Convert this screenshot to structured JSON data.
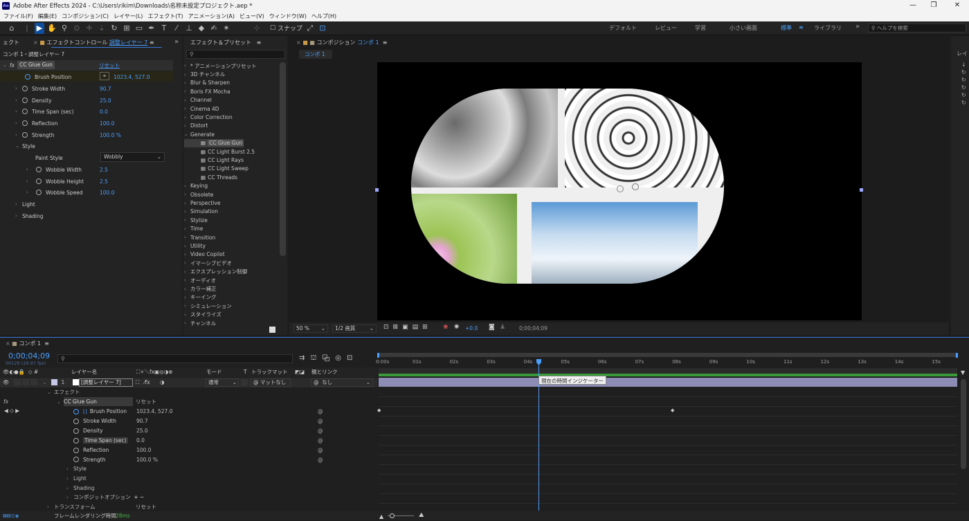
{
  "app": {
    "title": "Adobe After Effects 2024 - C:\\Users\\rikim\\Downloads\\名称未設定プロジェクト.aep *",
    "logo": "Ae"
  },
  "menu": [
    "ファイル(F)",
    "編集(E)",
    "コンポジション(C)",
    "レイヤー(L)",
    "エフェクト(T)",
    "アニメーション(A)",
    "ビュー(V)",
    "ウィンドウ(W)",
    "ヘルプ(H)"
  ],
  "toolbar": {
    "snap": "スナップ",
    "workspaces": [
      "デフォルト",
      "レビュー",
      "学習",
      "小さい画面",
      "標準",
      "ライブラリ"
    ],
    "active_workspace": "標準",
    "help_placeholder": "ヘルプを検索"
  },
  "effect_controls": {
    "left_tab": "ェクト",
    "tab_label": "エフェクトコントロール",
    "tab_layer": "調整レイヤー 7",
    "breadcrumb": "コンポ 1・調整レイヤー 7",
    "effect_name": "CC Glue Gun",
    "reset": "リセット",
    "props": [
      {
        "name": "Brush Position",
        "value": "1023.4, 527.0",
        "stop": true,
        "active": true
      },
      {
        "name": "Stroke Width",
        "value": "90.7"
      },
      {
        "name": "Density",
        "value": "25.0"
      },
      {
        "name": "Time Span (sec)",
        "value": "0.0"
      },
      {
        "name": "Reflection",
        "value": "100.0"
      },
      {
        "name": "Strength",
        "value": "100.0 %"
      }
    ],
    "style_group": "Style",
    "paint_style_label": "Paint Style",
    "paint_style_value": "Wobbly",
    "wobble": [
      {
        "name": "Wobble Width",
        "value": "2.5"
      },
      {
        "name": "Wobble Height",
        "value": "2.5"
      },
      {
        "name": "Wobble Speed",
        "value": "100.0"
      }
    ],
    "light": "Light",
    "shading": "Shading"
  },
  "effects_presets": {
    "tab": "エフェクト＆プリセット",
    "search_placeholder": "",
    "items": [
      {
        "label": "* アニメーションプリセット",
        "indent": 0
      },
      {
        "label": "3D チャンネル",
        "indent": 0
      },
      {
        "label": "Blur & Sharpen",
        "indent": 0
      },
      {
        "label": "Boris FX Mocha",
        "indent": 0
      },
      {
        "label": "Channel",
        "indent": 0
      },
      {
        "label": "Cinema 4D",
        "indent": 0
      },
      {
        "label": "Color Correction",
        "indent": 0
      },
      {
        "label": "Distort",
        "indent": 0
      },
      {
        "label": "Generate",
        "indent": 0,
        "open": true
      },
      {
        "label": "CC Glue Gun",
        "indent": 1,
        "selected": true
      },
      {
        "label": "CC Light Burst 2.5",
        "indent": 1
      },
      {
        "label": "CC Light Rays",
        "indent": 1
      },
      {
        "label": "CC Light Sweep",
        "indent": 1
      },
      {
        "label": "CC Threads",
        "indent": 1
      },
      {
        "label": "Keying",
        "indent": 0
      },
      {
        "label": "Obsolete",
        "indent": 0
      },
      {
        "label": "Perspective",
        "indent": 0
      },
      {
        "label": "Simulation",
        "indent": 0
      },
      {
        "label": "Stylize",
        "indent": 0
      },
      {
        "label": "Time",
        "indent": 0
      },
      {
        "label": "Transition",
        "indent": 0
      },
      {
        "label": "Utility",
        "indent": 0
      },
      {
        "label": "Video Copilot",
        "indent": 0
      },
      {
        "label": "イマーシブビデオ",
        "indent": 0
      },
      {
        "label": "エクスプレッション制御",
        "indent": 0
      },
      {
        "label": "オーディオ",
        "indent": 0
      },
      {
        "label": "カラー補正",
        "indent": 0
      },
      {
        "label": "キーイング",
        "indent": 0
      },
      {
        "label": "シミュレーション",
        "indent": 0
      },
      {
        "label": "スタイライズ",
        "indent": 0
      },
      {
        "label": "チャンネル",
        "indent": 0
      }
    ]
  },
  "composition": {
    "tab_label": "コンポジション",
    "comp_name": "コンポ 1",
    "subtab": "コンポ 1",
    "zoom": "50 %",
    "resolution": "1/2 画質",
    "exposure": "+0.0",
    "timecode": "0;00;04;09"
  },
  "timeline": {
    "tab": "コンポ 1",
    "timecode": "0;00;04;09",
    "frame_info": "00129 (29.97 fps)",
    "search_placeholder": "",
    "headers": {
      "layer_name": "レイヤー名",
      "mode": "モード",
      "t": "T",
      "track_matte": "トラックマット",
      "parent": "親とリンク",
      "num": "#"
    },
    "layer": {
      "num": "1",
      "name": "[調整レイヤー 7]",
      "mode": "通常",
      "matte": "マットなし",
      "parent": "なし"
    },
    "effects_group": "エフェクト",
    "effect_name": "CC Glue Gun",
    "reset": "リセット",
    "props": [
      {
        "name": "Brush Position",
        "value": "1023.4, 527.0"
      },
      {
        "name": "Stroke Width",
        "value": "90.7"
      },
      {
        "name": "Density",
        "value": "25.0"
      },
      {
        "name": "Time Span (sec)",
        "value": "0.0"
      },
      {
        "name": "Reflection",
        "value": "100.0"
      },
      {
        "name": "Strength",
        "value": "100.0 %"
      }
    ],
    "style": "Style",
    "light": "Light",
    "shading": "Shading",
    "composite": "コンポジットオプション",
    "composite_add": "+ −",
    "transform": "トランスフォーム",
    "transform_reset": "リセット",
    "render_label": "フレームレンダリング時間",
    "render_time": "28ms",
    "tooltip": "現在の時間インジケーター",
    "ticks": [
      "0:00s",
      "01s",
      "02s",
      "03s",
      "04s",
      "05s",
      "06s",
      "07s",
      "08s",
      "09s",
      "10s",
      "11s",
      "12s",
      "13s",
      "14s",
      "15s"
    ]
  },
  "colors": {
    "accent": "#2d8ceb",
    "layer_bar": "#8c8cb4",
    "selection": "#0d4f9e"
  }
}
